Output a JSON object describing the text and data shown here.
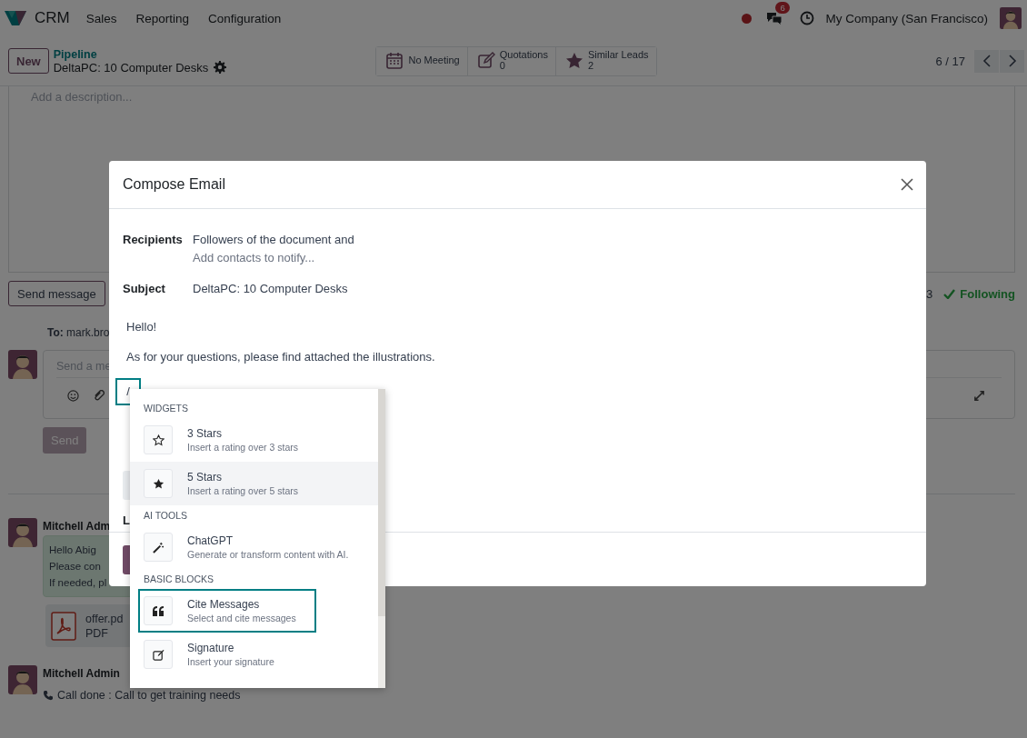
{
  "navbar": {
    "app": "CRM",
    "menu": [
      "Sales",
      "Reporting",
      "Configuration"
    ],
    "chat_badge": "6",
    "company": "My Company (San Francisco)"
  },
  "control_panel": {
    "new_button": "New",
    "breadcrumb": "Pipeline",
    "record_title": "DeltaPC: 10 Computer Desks",
    "smart_buttons": [
      {
        "kind": "meeting",
        "label": "No Meeting"
      },
      {
        "kind": "quotations",
        "label": "Quotations",
        "value": "0"
      },
      {
        "kind": "similar",
        "label": "Similar Leads",
        "value": "2"
      }
    ],
    "pager": "6 / 17"
  },
  "description": {
    "placeholder": "Add a description..."
  },
  "chatter": {
    "send_message_button": "Send message",
    "followers_count": "3",
    "following": "Following",
    "recipient": "**To:** mark.bro",
    "composer_placeholder": "Send a me",
    "send_button": "Send",
    "send_disabled": true,
    "messages": [
      {
        "kind": "note",
        "author": "Mitchell Adm",
        "lines": [
          "Hello Abig",
          "Please con",
          "If needed, pl"
        ],
        "attachment": {
          "name": "offer.pd",
          "type": "PDF"
        }
      },
      {
        "kind": "activity",
        "author": "Mitchell Admin",
        "text": "Call done : Call to get training needs"
      }
    ]
  },
  "dialog": {
    "title": "Compose Email",
    "fields": [
      {
        "label": "Recipients",
        "value": "Followers of the document and",
        "placeholder": "Add contacts to notify..."
      },
      {
        "label": "Subject",
        "value": "DeltaPC: 10 Computer Desks"
      }
    ],
    "body": [
      "Hello!",
      "As for your questions, please find attached the illustrations."
    ],
    "command": "/",
    "command_outlined": true,
    "partial_label": "L"
  },
  "command_menu": {
    "sections": [
      {
        "title": "WIDGETS",
        "items": [
          {
            "kind": "star-outline",
            "title": "3 Stars",
            "description": "Insert a rating over 3 stars",
            "selected": false,
            "outlined": false
          },
          {
            "kind": "star-solid",
            "title": "5 Stars",
            "description": "Insert a rating over 5 stars",
            "selected": true,
            "outlined": false
          }
        ]
      },
      {
        "title": "AI TOOLS",
        "items": [
          {
            "kind": "wand",
            "title": "ChatGPT",
            "description": "Generate or transform content with AI.",
            "selected": false,
            "outlined": false
          }
        ]
      },
      {
        "title": "BASIC BLOCKS",
        "items": [
          {
            "kind": "quote",
            "title": "Cite Messages",
            "description": "Select and cite messages",
            "selected": false,
            "outlined": true
          },
          {
            "kind": "signature",
            "title": "Signature",
            "description": "Insert your signature",
            "selected": false,
            "outlined": false
          }
        ]
      }
    ]
  }
}
